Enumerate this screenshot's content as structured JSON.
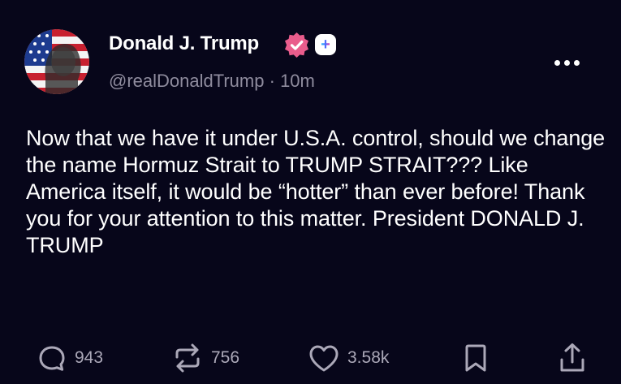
{
  "post": {
    "author_name": "Donald J. Trump",
    "handle": "@realDonaldTrump",
    "separator": "·",
    "time": "10m",
    "plus_badge": "+",
    "body": "Now that we have it under U.S.A. control, should we change the name Hormuz Strait to TRUMP STRAIT??? Like America itself, it would be “hotter” than ever before! Thank you for your attention to this matter. President DONALD J. TRUMP"
  },
  "actions": {
    "replies": "943",
    "reposts": "756",
    "likes": "3.58k"
  },
  "icons": [
    "avatar",
    "verified-badge-icon",
    "plus-badge-icon",
    "more-options-icon",
    "reply-icon",
    "repost-icon",
    "like-icon",
    "bookmark-icon",
    "share-icon"
  ],
  "colors": {
    "background": "#07061a",
    "text": "#ffffff",
    "muted": "#8f8c9e",
    "verified": "#e95c8c"
  }
}
